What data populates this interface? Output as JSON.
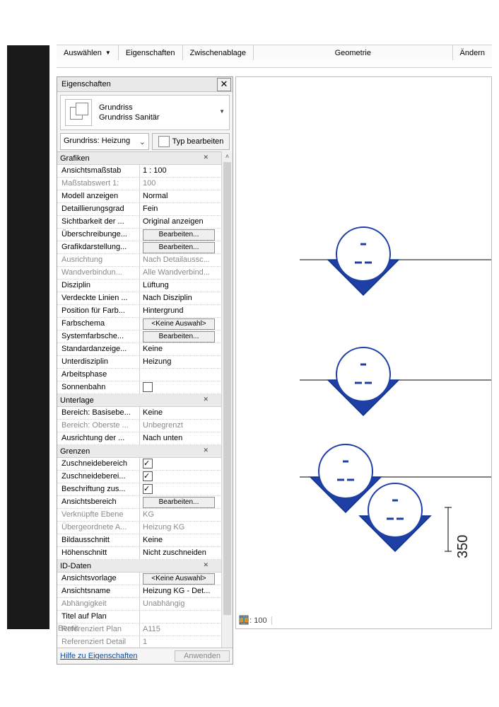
{
  "ribbon": {
    "auswahl": "Auswählen",
    "eigenschaften": "Eigenschaften",
    "zwischenablage": "Zwischenablage",
    "geometrie": "Geometrie",
    "aendern": "Ändern"
  },
  "panel": {
    "title": "Eigenschaften",
    "header": {
      "line1": "Grundriss",
      "line2": "Grundriss Sanitär"
    },
    "type_selector": "Grundriss: Heizung KG",
    "type_edit": "Typ bearbeiten",
    "help_link": "Hilfe zu Eigenschaften",
    "apply": "Anwenden",
    "groups": {
      "grafiken": "Grafiken",
      "unterlage": "Unterlage",
      "grenzen": "Grenzen",
      "iddaten": "ID-Daten"
    },
    "rows": {
      "ansichtsmassstab": {
        "l": "Ansichtsmaßstab",
        "v": "1 : 100"
      },
      "massstabswert": {
        "l": "Maßstabswert 1:",
        "v": "100"
      },
      "modell_anzeigen": {
        "l": "Modell anzeigen",
        "v": "Normal"
      },
      "detailgrad": {
        "l": "Detaillierungsgrad",
        "v": "Fein"
      },
      "sichtbarkeit": {
        "l": "Sichtbarkeit der ...",
        "v": "Original anzeigen"
      },
      "ueberschreibung": {
        "l": "Überschreibunge...",
        "btn": "Bearbeiten..."
      },
      "grafikdarst": {
        "l": "Grafikdarstellung...",
        "btn": "Bearbeiten..."
      },
      "ausrichtung": {
        "l": "Ausrichtung",
        "v": "Nach Detailaussc..."
      },
      "wandverbind": {
        "l": "Wandverbindun...",
        "v": "Alle Wandverbind..."
      },
      "disziplin": {
        "l": "Disziplin",
        "v": "Lüftung"
      },
      "verdeckte": {
        "l": "Verdeckte Linien ...",
        "v": "Nach Disziplin"
      },
      "position_farb": {
        "l": "Position für Farb...",
        "v": "Hintergrund"
      },
      "farbschema": {
        "l": "Farbschema",
        "btn": "<Keine Auswahl>"
      },
      "systemfarb": {
        "l": "Systemfarbsche...",
        "btn": "Bearbeiten..."
      },
      "standardanz": {
        "l": "Standardanzeige...",
        "v": "Keine"
      },
      "unterdisziplin": {
        "l": "Unterdisziplin",
        "v": "Heizung"
      },
      "arbeitsphase": {
        "l": "Arbeitsphase",
        "v": ""
      },
      "sonnenbahn": {
        "l": "Sonnenbahn"
      },
      "bereich_basis": {
        "l": "Bereich: Basisebe...",
        "v": "Keine"
      },
      "bereich_oberste": {
        "l": "Bereich: Oberste ...",
        "v": "Unbegrenzt"
      },
      "ausrichtung_der": {
        "l": "Ausrichtung der ...",
        "v": "Nach unten"
      },
      "zuschneide1": {
        "l": "Zuschneidebereich"
      },
      "zuschneide2": {
        "l": "Zuschneideberei..."
      },
      "beschriftung": {
        "l": "Beschriftung zus..."
      },
      "ansichtsbereich": {
        "l": "Ansichtsbereich",
        "btn": "Bearbeiten..."
      },
      "verknuepfte": {
        "l": "Verknüpfte Ebene",
        "v": "KG"
      },
      "uebergeordnete": {
        "l": "Übergeordnete A...",
        "v": "Heizung KG"
      },
      "bildausschnitt": {
        "l": "Bildausschnitt",
        "v": "Keine"
      },
      "hoehenschnitt": {
        "l": "Höhenschnitt",
        "v": "Nicht zuschneiden"
      },
      "ansichtsvorlage": {
        "l": "Ansichtsvorlage",
        "btn": "<Keine Auswahl>"
      },
      "ansichtsname": {
        "l": "Ansichtsname",
        "v": "Heizung KG - Det..."
      },
      "abhaengigkeit": {
        "l": "Abhängigkeit",
        "v": "Unabhängig"
      },
      "titel_plan": {
        "l": "Titel auf Plan",
        "v": ""
      },
      "ref_plan": {
        "l": "Referenziert Plan",
        "v": "A115"
      },
      "ref_detail": {
        "l": "Referenziert Detail",
        "v": "1"
      }
    }
  },
  "viewport": {
    "scale_label": "1 : 100",
    "dimension_text": "350"
  },
  "status_bar": {
    "ready": "Bereit"
  }
}
